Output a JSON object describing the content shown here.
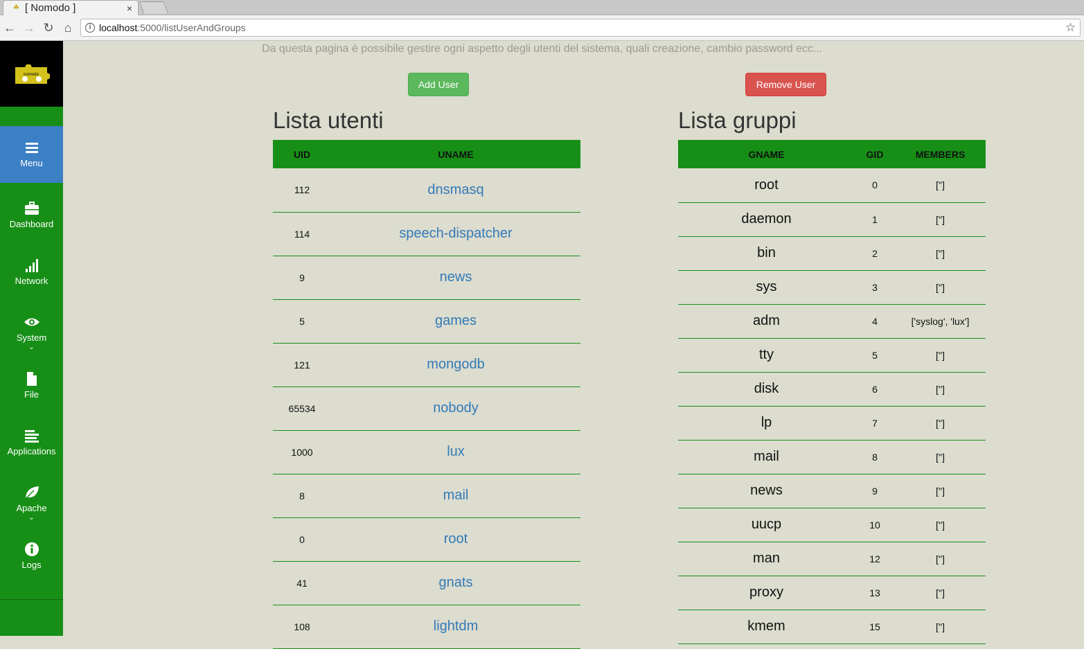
{
  "browser": {
    "tab_title": "[ Nomodo ]",
    "close_glyph": "×",
    "url_host": "localhost",
    "url_path": ":5000/listUserAndGroups"
  },
  "sidebar": {
    "logo_text": "nomodo",
    "items": [
      {
        "label": "Menu",
        "icon": "menu-icon"
      },
      {
        "label": "Dashboard",
        "icon": "briefcase-icon"
      },
      {
        "label": "Network",
        "icon": "signal-icon"
      },
      {
        "label": "System",
        "icon": "eye-icon"
      },
      {
        "label": "File",
        "icon": "file-icon"
      },
      {
        "label": "Applications",
        "icon": "list-icon"
      },
      {
        "label": "Apache",
        "icon": "leaf-icon"
      },
      {
        "label": "Logs",
        "icon": "info-icon"
      }
    ]
  },
  "main": {
    "subtitle": "Da questa pagina è possibile gestire ogni aspetto degli utenti del sistema, quali creazione, cambio password ecc...",
    "add_user_label": "Add User",
    "remove_user_label": "Remove User",
    "users_heading": "Lista utenti",
    "groups_heading": "Lista gruppi",
    "users_columns": [
      "UID",
      "UNAME"
    ],
    "users": [
      {
        "uid": "112",
        "uname": "dnsmasq"
      },
      {
        "uid": "114",
        "uname": "speech-dispatcher"
      },
      {
        "uid": "9",
        "uname": "news"
      },
      {
        "uid": "5",
        "uname": "games"
      },
      {
        "uid": "121",
        "uname": "mongodb"
      },
      {
        "uid": "65534",
        "uname": "nobody"
      },
      {
        "uid": "1000",
        "uname": "lux"
      },
      {
        "uid": "8",
        "uname": "mail"
      },
      {
        "uid": "0",
        "uname": "root"
      },
      {
        "uid": "41",
        "uname": "gnats"
      },
      {
        "uid": "108",
        "uname": "lightdm"
      }
    ],
    "groups_columns": [
      "GNAME",
      "GID",
      "MEMBERS"
    ],
    "groups": [
      {
        "gname": "root",
        "gid": "0",
        "members": "['']"
      },
      {
        "gname": "daemon",
        "gid": "1",
        "members": "['']"
      },
      {
        "gname": "bin",
        "gid": "2",
        "members": "['']"
      },
      {
        "gname": "sys",
        "gid": "3",
        "members": "['']"
      },
      {
        "gname": "adm",
        "gid": "4",
        "members": "['syslog', 'lux']"
      },
      {
        "gname": "tty",
        "gid": "5",
        "members": "['']"
      },
      {
        "gname": "disk",
        "gid": "6",
        "members": "['']"
      },
      {
        "gname": "lp",
        "gid": "7",
        "members": "['']"
      },
      {
        "gname": "mail",
        "gid": "8",
        "members": "['']"
      },
      {
        "gname": "news",
        "gid": "9",
        "members": "['']"
      },
      {
        "gname": "uucp",
        "gid": "10",
        "members": "['']"
      },
      {
        "gname": "man",
        "gid": "12",
        "members": "['']"
      },
      {
        "gname": "proxy",
        "gid": "13",
        "members": "['']"
      },
      {
        "gname": "kmem",
        "gid": "15",
        "members": "['']"
      }
    ]
  }
}
